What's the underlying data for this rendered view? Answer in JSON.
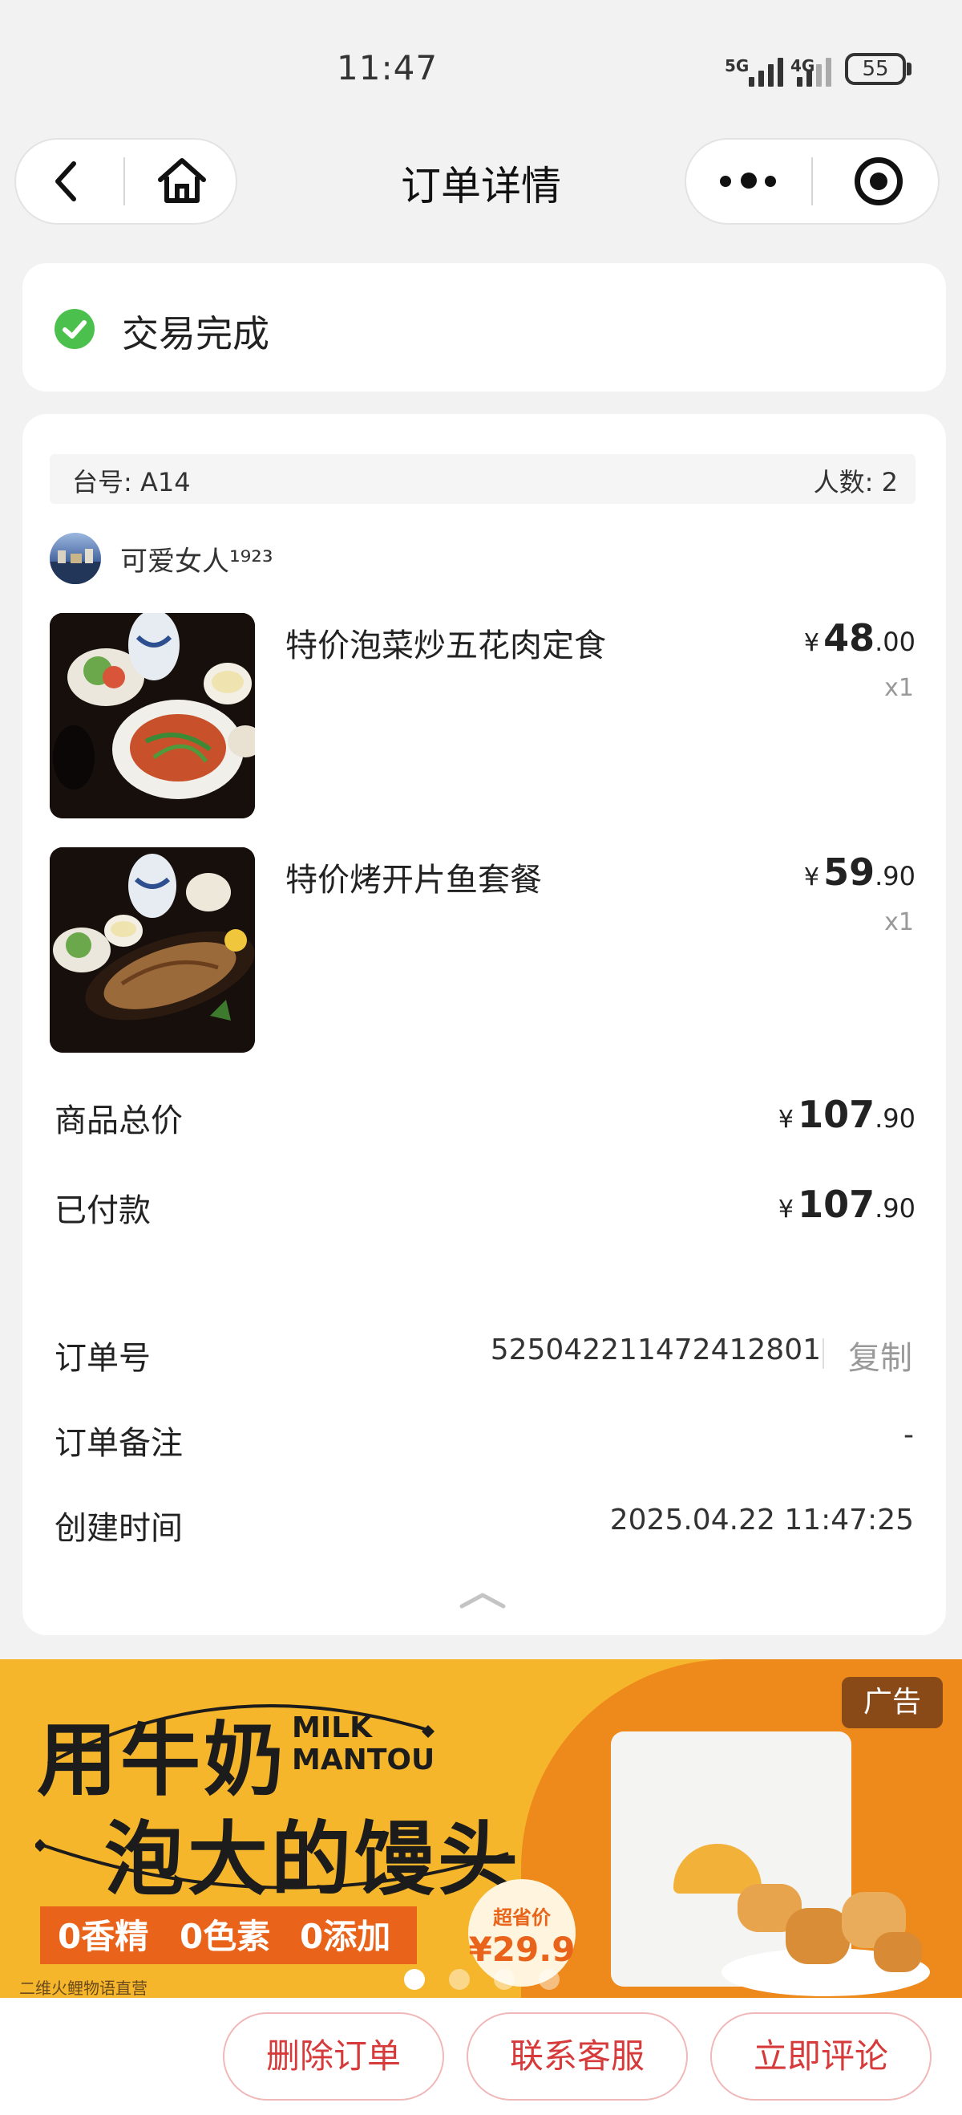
{
  "status_bar": {
    "time": "11:47",
    "net1": "5G",
    "net2": "4G",
    "battery": "55"
  },
  "nav": {
    "title": "订单详情"
  },
  "order_status": {
    "text": "交易完成"
  },
  "table_info": {
    "table_label": "台号: A14",
    "people_label": "人数: 2"
  },
  "user": {
    "name": "可爱女人¹⁹²³"
  },
  "items": [
    {
      "name": "特价泡菜炒五花肉定食",
      "currency": "¥",
      "price_int": "48",
      "price_dec": ".00",
      "qty": "x1"
    },
    {
      "name": "特价烤开片鱼套餐",
      "currency": "¥",
      "price_int": "59",
      "price_dec": ".90",
      "qty": "x1"
    }
  ],
  "summary": {
    "total_label": "商品总价",
    "total_currency": "¥",
    "total_int": "107",
    "total_dec": ".90",
    "paid_label": "已付款",
    "paid_currency": "¥",
    "paid_int": "107",
    "paid_dec": ".90"
  },
  "details": {
    "order_no_label": "订单号",
    "order_no": "525042211472412801",
    "copy_label": "复制",
    "remark_label": "订单备注",
    "remark": "-",
    "created_label": "创建时间",
    "created": "2025.04.22 11:47:25"
  },
  "ad": {
    "line1": "用牛奶",
    "line2": "泡大的馒头",
    "milk": "MILK",
    "mantou": "MANTOU",
    "features": [
      "0香精",
      "0色素",
      "0添加"
    ],
    "badge": "广告",
    "price_tag": "超省价",
    "price": "¥29.9",
    "footer": "二维火鲤物语直营"
  },
  "actions": {
    "delete": "删除订单",
    "service": "联系客服",
    "review": "立即评论"
  },
  "colors": {
    "accent": "#d63a3a",
    "success": "#4cc04c",
    "ad_yellow": "#f6b62b",
    "ad_orange": "#ee8a1c"
  }
}
